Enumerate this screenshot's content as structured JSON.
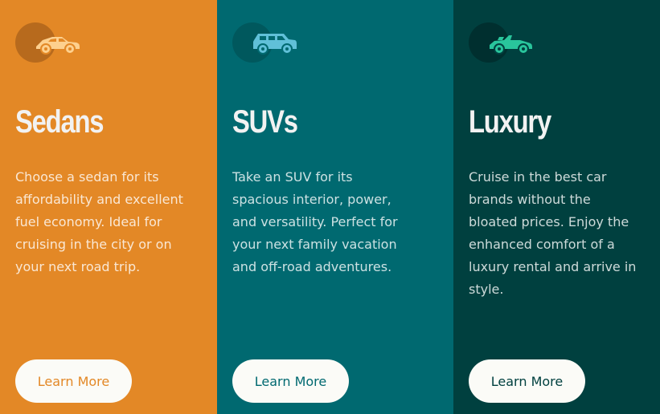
{
  "cards": [
    {
      "icon": "sedan-car-icon",
      "title": "Sedans",
      "description": "Choose a sedan for its affordability and excellent fuel economy. Ideal for cruising in the city or on your next road trip.",
      "button_label": "Learn More",
      "background": "#e38826",
      "icon_color": "#fdd08e"
    },
    {
      "icon": "suv-car-icon",
      "title": "SUVs",
      "description": "Take an SUV for its spacious interior, power, and versatility. Perfect for your next family vacation and off-road adventures.",
      "button_label": "Learn More",
      "background": "#006970",
      "icon_color": "#60c0d8"
    },
    {
      "icon": "luxury-car-icon",
      "title": "Luxury",
      "description": "Cruise in the best car brands without the bloated prices. Enjoy the enhanced comfort of a luxury rental and arrive in style.",
      "button_label": "Learn More",
      "background": "#00403f",
      "icon_color": "#29c59c"
    }
  ]
}
